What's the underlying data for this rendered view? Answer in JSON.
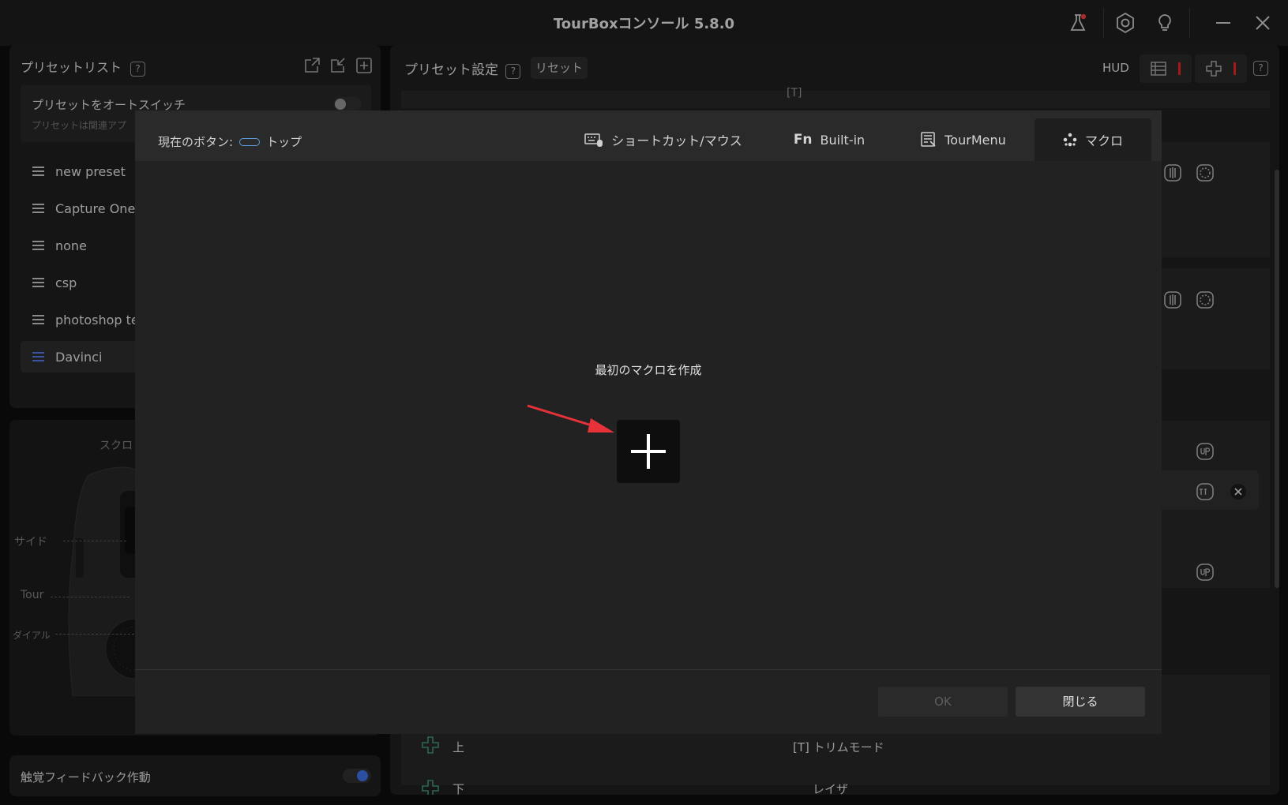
{
  "app": {
    "title": "TourBoxコンソール 5.8.0"
  },
  "titlebar": {
    "icons": [
      "lab-flask-icon",
      "settings-hexagon-icon",
      "lightbulb-icon",
      "minimize-icon",
      "close-icon"
    ],
    "notify_color": "#e23a3a"
  },
  "preset_list": {
    "title": "プリセットリスト",
    "help": "?",
    "header_icons": [
      "export-icon",
      "import-icon",
      "add-icon"
    ],
    "auto_switch": {
      "label": "プリセットをオートスイッチ",
      "sub": "プリセットは関連アプ",
      "enabled": false
    },
    "items": [
      {
        "label": "new preset"
      },
      {
        "label": "Capture One"
      },
      {
        "label": "none"
      },
      {
        "label": "csp"
      },
      {
        "label": "photoshop te"
      },
      {
        "label": "Davinci",
        "active": true
      }
    ]
  },
  "device": {
    "labels": {
      "scroll": "スクロ",
      "side": "サイド",
      "tour": "Tour",
      "dial": "ダイアル"
    }
  },
  "haptic": {
    "label": "触覚フィードバック作動",
    "enabled": true
  },
  "preset_settings": {
    "title": "プリセット設定",
    "help": "?",
    "reset_label": "リセット",
    "hud_label": "HUD",
    "rows_bottom": [
      {
        "name": "上",
        "value": "[T] トリムモード"
      },
      {
        "name": "下",
        "value": "レイザ"
      }
    ],
    "top_cut_text": "[T]"
  },
  "dialog": {
    "current_button_label": "現在のボタン:",
    "current_button_name": "トップ",
    "tabs": [
      {
        "label": "ショートカット/マウス",
        "icon": "keyboard-mouse-icon"
      },
      {
        "label": "Built-in",
        "icon": "fn-icon"
      },
      {
        "label": "TourMenu",
        "icon": "tourmenu-icon"
      },
      {
        "label": "マクロ",
        "icon": "macro-icon",
        "active": true
      }
    ],
    "empty_caption": "最初のマクロを作成",
    "ok_label": "OK",
    "close_label": "閉じる",
    "accent": "#e8323a"
  }
}
